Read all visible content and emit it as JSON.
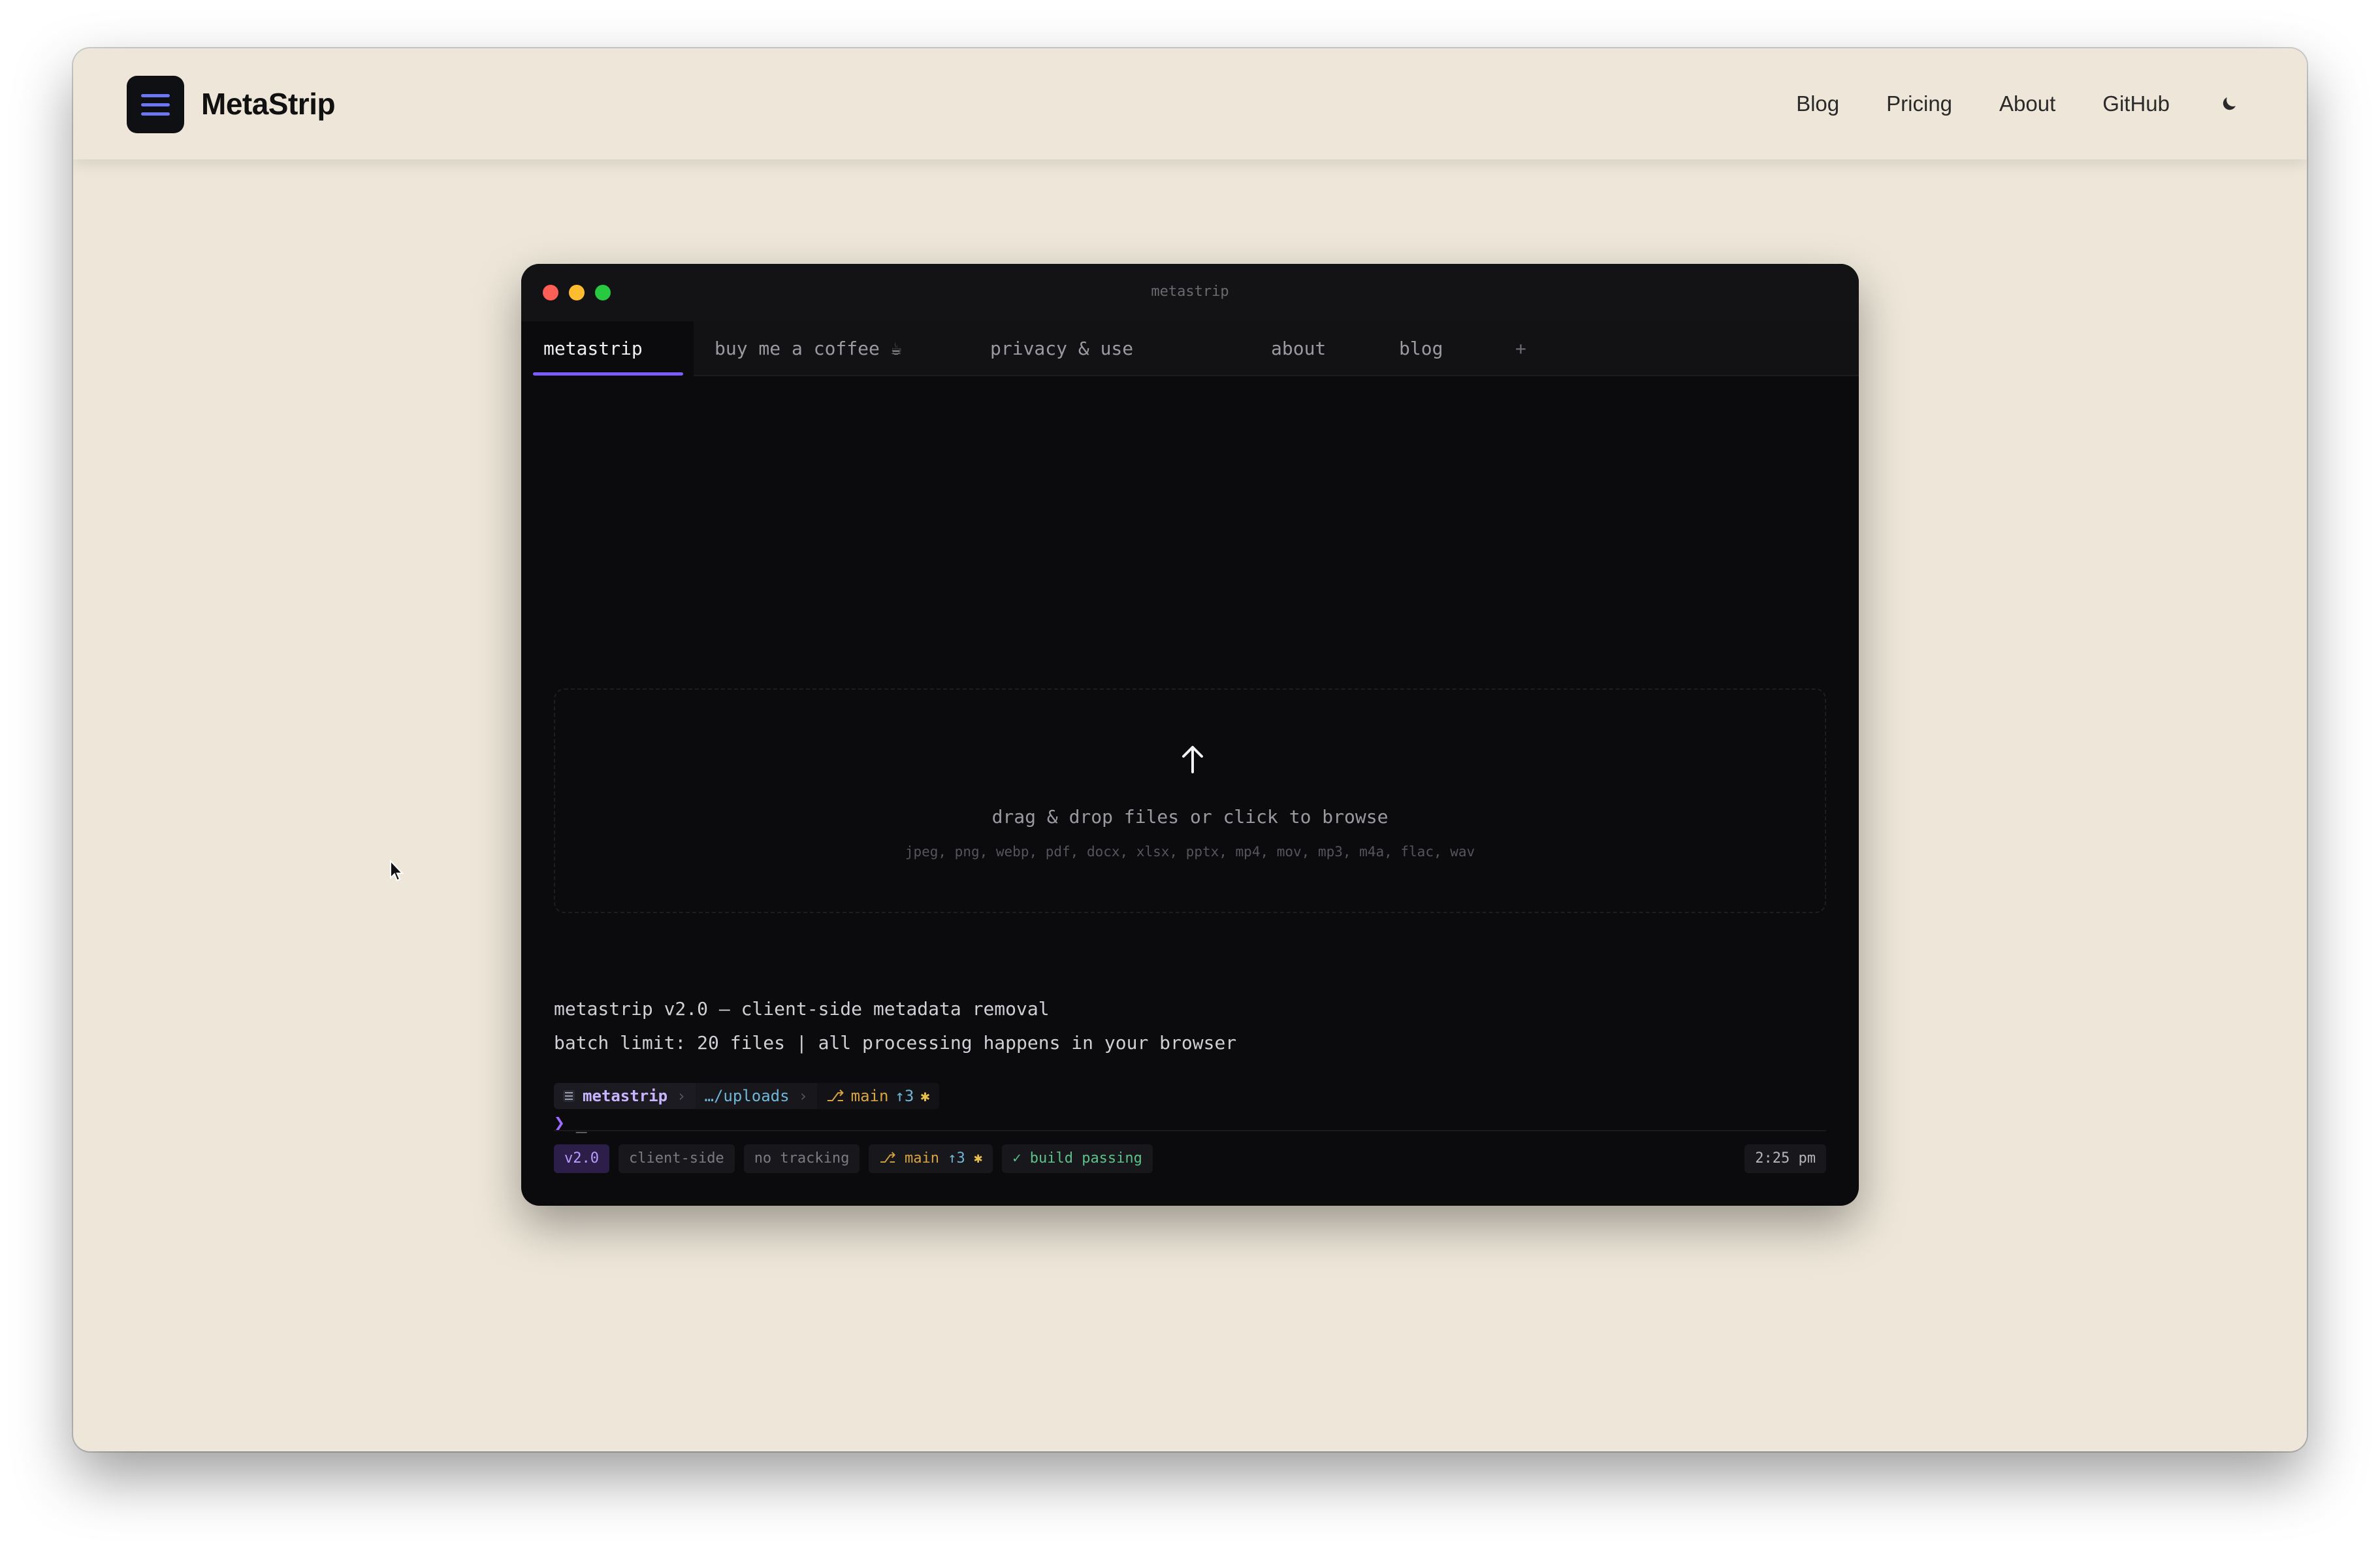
{
  "nav": {
    "brand": "MetaStrip",
    "links": [
      "Blog",
      "Pricing",
      "About",
      "GitHub"
    ],
    "theme_icon": "moon-icon",
    "menu_icon": "menu-icon"
  },
  "terminal": {
    "title": "metastrip",
    "tabs": [
      "metastrip",
      "buy me a coffee ☕",
      "privacy & use",
      "about",
      "blog",
      "+"
    ],
    "dropzone": {
      "text": "drag & drop files or click to browse",
      "formats": "jpeg, png, webp, pdf, docx, xlsx, pptx, mp4, mov, mp3, m4a, flac, wav",
      "icon": "upload-arrow-icon"
    },
    "lines": [
      "metastrip v2.0 — client-side metadata removal",
      "batch limit: 20 files | all processing happens in your browser"
    ],
    "prompt": {
      "project": "metastrip",
      "path": "…/uploads",
      "branch": "main",
      "ahead": "↑3",
      "dirty": "✱",
      "symbol": "❯",
      "cursor": "_"
    },
    "status": {
      "version": "v2.0",
      "tags": [
        "client-side",
        "no tracking"
      ],
      "branch": "main",
      "ahead": "↑3",
      "dirty": "✱",
      "build": "✓ build passing",
      "time": "2:25 pm"
    }
  },
  "colors": {
    "page_bg": "#ede6d9",
    "terminal_bg": "#0b0b0d",
    "accent": "#7c5cff",
    "brand_icon_bg": "#0f1013"
  }
}
